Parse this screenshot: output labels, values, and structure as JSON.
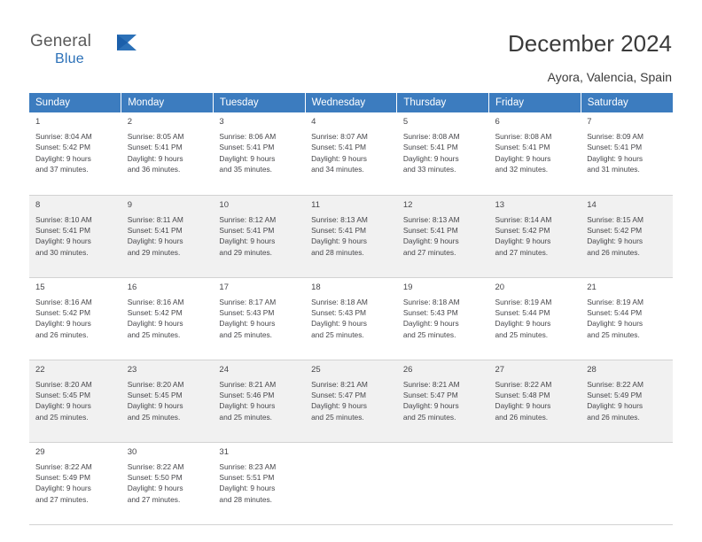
{
  "brand": {
    "word1": "General",
    "word2": "Blue",
    "flag_icon": "blue-flag-icon",
    "color_primary": "#2c71b8",
    "color_gray": "#5a5a5a"
  },
  "header": {
    "title": "December 2024",
    "location": "Ayora, Valencia, Spain"
  },
  "calendar": {
    "header_bg": "#3c7cbf",
    "weekdays": [
      "Sunday",
      "Monday",
      "Tuesday",
      "Wednesday",
      "Thursday",
      "Friday",
      "Saturday"
    ],
    "weeks": [
      [
        {
          "day": "1",
          "sunrise": "Sunrise: 8:04 AM",
          "sunset": "Sunset: 5:42 PM",
          "daylight1": "Daylight: 9 hours",
          "daylight2": "and 37 minutes."
        },
        {
          "day": "2",
          "sunrise": "Sunrise: 8:05 AM",
          "sunset": "Sunset: 5:41 PM",
          "daylight1": "Daylight: 9 hours",
          "daylight2": "and 36 minutes."
        },
        {
          "day": "3",
          "sunrise": "Sunrise: 8:06 AM",
          "sunset": "Sunset: 5:41 PM",
          "daylight1": "Daylight: 9 hours",
          "daylight2": "and 35 minutes."
        },
        {
          "day": "4",
          "sunrise": "Sunrise: 8:07 AM",
          "sunset": "Sunset: 5:41 PM",
          "daylight1": "Daylight: 9 hours",
          "daylight2": "and 34 minutes."
        },
        {
          "day": "5",
          "sunrise": "Sunrise: 8:08 AM",
          "sunset": "Sunset: 5:41 PM",
          "daylight1": "Daylight: 9 hours",
          "daylight2": "and 33 minutes."
        },
        {
          "day": "6",
          "sunrise": "Sunrise: 8:08 AM",
          "sunset": "Sunset: 5:41 PM",
          "daylight1": "Daylight: 9 hours",
          "daylight2": "and 32 minutes."
        },
        {
          "day": "7",
          "sunrise": "Sunrise: 8:09 AM",
          "sunset": "Sunset: 5:41 PM",
          "daylight1": "Daylight: 9 hours",
          "daylight2": "and 31 minutes."
        }
      ],
      [
        {
          "day": "8",
          "sunrise": "Sunrise: 8:10 AM",
          "sunset": "Sunset: 5:41 PM",
          "daylight1": "Daylight: 9 hours",
          "daylight2": "and 30 minutes."
        },
        {
          "day": "9",
          "sunrise": "Sunrise: 8:11 AM",
          "sunset": "Sunset: 5:41 PM",
          "daylight1": "Daylight: 9 hours",
          "daylight2": "and 29 minutes."
        },
        {
          "day": "10",
          "sunrise": "Sunrise: 8:12 AM",
          "sunset": "Sunset: 5:41 PM",
          "daylight1": "Daylight: 9 hours",
          "daylight2": "and 29 minutes."
        },
        {
          "day": "11",
          "sunrise": "Sunrise: 8:13 AM",
          "sunset": "Sunset: 5:41 PM",
          "daylight1": "Daylight: 9 hours",
          "daylight2": "and 28 minutes."
        },
        {
          "day": "12",
          "sunrise": "Sunrise: 8:13 AM",
          "sunset": "Sunset: 5:41 PM",
          "daylight1": "Daylight: 9 hours",
          "daylight2": "and 27 minutes."
        },
        {
          "day": "13",
          "sunrise": "Sunrise: 8:14 AM",
          "sunset": "Sunset: 5:42 PM",
          "daylight1": "Daylight: 9 hours",
          "daylight2": "and 27 minutes."
        },
        {
          "day": "14",
          "sunrise": "Sunrise: 8:15 AM",
          "sunset": "Sunset: 5:42 PM",
          "daylight1": "Daylight: 9 hours",
          "daylight2": "and 26 minutes."
        }
      ],
      [
        {
          "day": "15",
          "sunrise": "Sunrise: 8:16 AM",
          "sunset": "Sunset: 5:42 PM",
          "daylight1": "Daylight: 9 hours",
          "daylight2": "and 26 minutes."
        },
        {
          "day": "16",
          "sunrise": "Sunrise: 8:16 AM",
          "sunset": "Sunset: 5:42 PM",
          "daylight1": "Daylight: 9 hours",
          "daylight2": "and 25 minutes."
        },
        {
          "day": "17",
          "sunrise": "Sunrise: 8:17 AM",
          "sunset": "Sunset: 5:43 PM",
          "daylight1": "Daylight: 9 hours",
          "daylight2": "and 25 minutes."
        },
        {
          "day": "18",
          "sunrise": "Sunrise: 8:18 AM",
          "sunset": "Sunset: 5:43 PM",
          "daylight1": "Daylight: 9 hours",
          "daylight2": "and 25 minutes."
        },
        {
          "day": "19",
          "sunrise": "Sunrise: 8:18 AM",
          "sunset": "Sunset: 5:43 PM",
          "daylight1": "Daylight: 9 hours",
          "daylight2": "and 25 minutes."
        },
        {
          "day": "20",
          "sunrise": "Sunrise: 8:19 AM",
          "sunset": "Sunset: 5:44 PM",
          "daylight1": "Daylight: 9 hours",
          "daylight2": "and 25 minutes."
        },
        {
          "day": "21",
          "sunrise": "Sunrise: 8:19 AM",
          "sunset": "Sunset: 5:44 PM",
          "daylight1": "Daylight: 9 hours",
          "daylight2": "and 25 minutes."
        }
      ],
      [
        {
          "day": "22",
          "sunrise": "Sunrise: 8:20 AM",
          "sunset": "Sunset: 5:45 PM",
          "daylight1": "Daylight: 9 hours",
          "daylight2": "and 25 minutes."
        },
        {
          "day": "23",
          "sunrise": "Sunrise: 8:20 AM",
          "sunset": "Sunset: 5:45 PM",
          "daylight1": "Daylight: 9 hours",
          "daylight2": "and 25 minutes."
        },
        {
          "day": "24",
          "sunrise": "Sunrise: 8:21 AM",
          "sunset": "Sunset: 5:46 PM",
          "daylight1": "Daylight: 9 hours",
          "daylight2": "and 25 minutes."
        },
        {
          "day": "25",
          "sunrise": "Sunrise: 8:21 AM",
          "sunset": "Sunset: 5:47 PM",
          "daylight1": "Daylight: 9 hours",
          "daylight2": "and 25 minutes."
        },
        {
          "day": "26",
          "sunrise": "Sunrise: 8:21 AM",
          "sunset": "Sunset: 5:47 PM",
          "daylight1": "Daylight: 9 hours",
          "daylight2": "and 25 minutes."
        },
        {
          "day": "27",
          "sunrise": "Sunrise: 8:22 AM",
          "sunset": "Sunset: 5:48 PM",
          "daylight1": "Daylight: 9 hours",
          "daylight2": "and 26 minutes."
        },
        {
          "day": "28",
          "sunrise": "Sunrise: 8:22 AM",
          "sunset": "Sunset: 5:49 PM",
          "daylight1": "Daylight: 9 hours",
          "daylight2": "and 26 minutes."
        }
      ],
      [
        {
          "day": "29",
          "sunrise": "Sunrise: 8:22 AM",
          "sunset": "Sunset: 5:49 PM",
          "daylight1": "Daylight: 9 hours",
          "daylight2": "and 27 minutes."
        },
        {
          "day": "30",
          "sunrise": "Sunrise: 8:22 AM",
          "sunset": "Sunset: 5:50 PM",
          "daylight1": "Daylight: 9 hours",
          "daylight2": "and 27 minutes."
        },
        {
          "day": "31",
          "sunrise": "Sunrise: 8:23 AM",
          "sunset": "Sunset: 5:51 PM",
          "daylight1": "Daylight: 9 hours",
          "daylight2": "and 28 minutes."
        },
        {
          "day": "",
          "sunrise": "",
          "sunset": "",
          "daylight1": "",
          "daylight2": ""
        },
        {
          "day": "",
          "sunrise": "",
          "sunset": "",
          "daylight1": "",
          "daylight2": ""
        },
        {
          "day": "",
          "sunrise": "",
          "sunset": "",
          "daylight1": "",
          "daylight2": ""
        },
        {
          "day": "",
          "sunrise": "",
          "sunset": "",
          "daylight1": "",
          "daylight2": ""
        }
      ]
    ]
  }
}
